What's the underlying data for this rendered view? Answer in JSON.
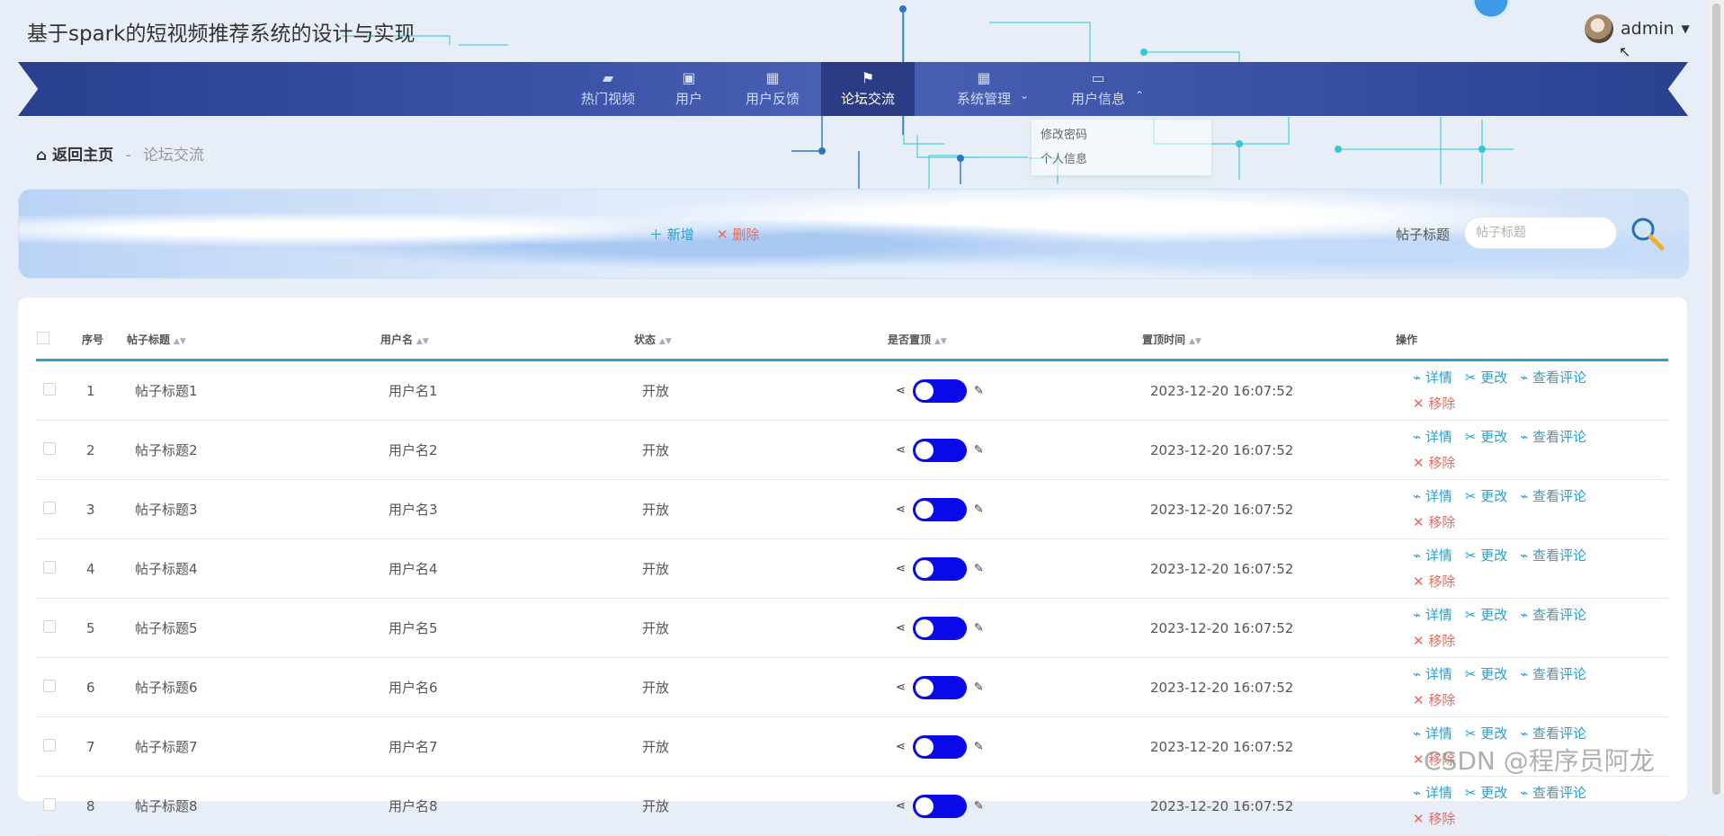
{
  "header": {
    "app_title": "基于spark的短视频推荐系统的设计与实现",
    "username": "admin"
  },
  "nav": [
    {
      "label": "热门视频",
      "icon": "briefcase-icon"
    },
    {
      "label": "用户",
      "icon": "clipboard-icon"
    },
    {
      "label": "用户反馈",
      "icon": "grid-icon"
    },
    {
      "label": "论坛交流",
      "icon": "flag-icon",
      "active": true
    },
    {
      "label": "系统管理",
      "icon": "grid-icon"
    },
    {
      "label": "用户信息",
      "icon": "card-icon"
    }
  ],
  "submenu": {
    "items": [
      "修改密码",
      "个人信息"
    ]
  },
  "breadcrumb": {
    "home": "返回主页",
    "separator": "-",
    "current": "论坛交流"
  },
  "toolbar": {
    "add_label": "新增",
    "delete_label": "删除",
    "search_label": "帖子标题",
    "search_placeholder": "帖子标题",
    "search_value": ""
  },
  "table": {
    "headers": {
      "index": "序号",
      "title": "帖子标题",
      "username": "用户名",
      "status": "状态",
      "pinned": "是否置顶",
      "pin_time": "置顶时间",
      "actions": "操作"
    },
    "rows": [
      {
        "index": "1",
        "title": "帖子标题1",
        "username": "用户名1",
        "status": "开放",
        "pinned": true,
        "pin_time": "2023-12-20 16:07:52"
      },
      {
        "index": "2",
        "title": "帖子标题2",
        "username": "用户名2",
        "status": "开放",
        "pinned": true,
        "pin_time": "2023-12-20 16:07:52"
      },
      {
        "index": "3",
        "title": "帖子标题3",
        "username": "用户名3",
        "status": "开放",
        "pinned": true,
        "pin_time": "2023-12-20 16:07:52"
      },
      {
        "index": "4",
        "title": "帖子标题4",
        "username": "用户名4",
        "status": "开放",
        "pinned": true,
        "pin_time": "2023-12-20 16:07:52"
      },
      {
        "index": "5",
        "title": "帖子标题5",
        "username": "用户名5",
        "status": "开放",
        "pinned": true,
        "pin_time": "2023-12-20 16:07:52"
      },
      {
        "index": "6",
        "title": "帖子标题6",
        "username": "用户名6",
        "status": "开放",
        "pinned": true,
        "pin_time": "2023-12-20 16:07:52"
      },
      {
        "index": "7",
        "title": "帖子标题7",
        "username": "用户名7",
        "status": "开放",
        "pinned": true,
        "pin_time": "2023-12-20 16:07:52"
      },
      {
        "index": "8",
        "title": "帖子标题8",
        "username": "用户名8",
        "status": "开放",
        "pinned": true,
        "pin_time": "2023-12-20 16:07:52"
      }
    ],
    "actions": {
      "detail": "详情",
      "edit": "更改",
      "comments": "查看评论",
      "remove": "移除"
    }
  },
  "watermark": "CSDN @程序员阿龙",
  "colors": {
    "nav_bg": "#3d54a8",
    "nav_active": "#2b3c84",
    "accent": "#2aa0d0",
    "danger": "#e8685f",
    "toggle_on": "#0a0ae8"
  }
}
